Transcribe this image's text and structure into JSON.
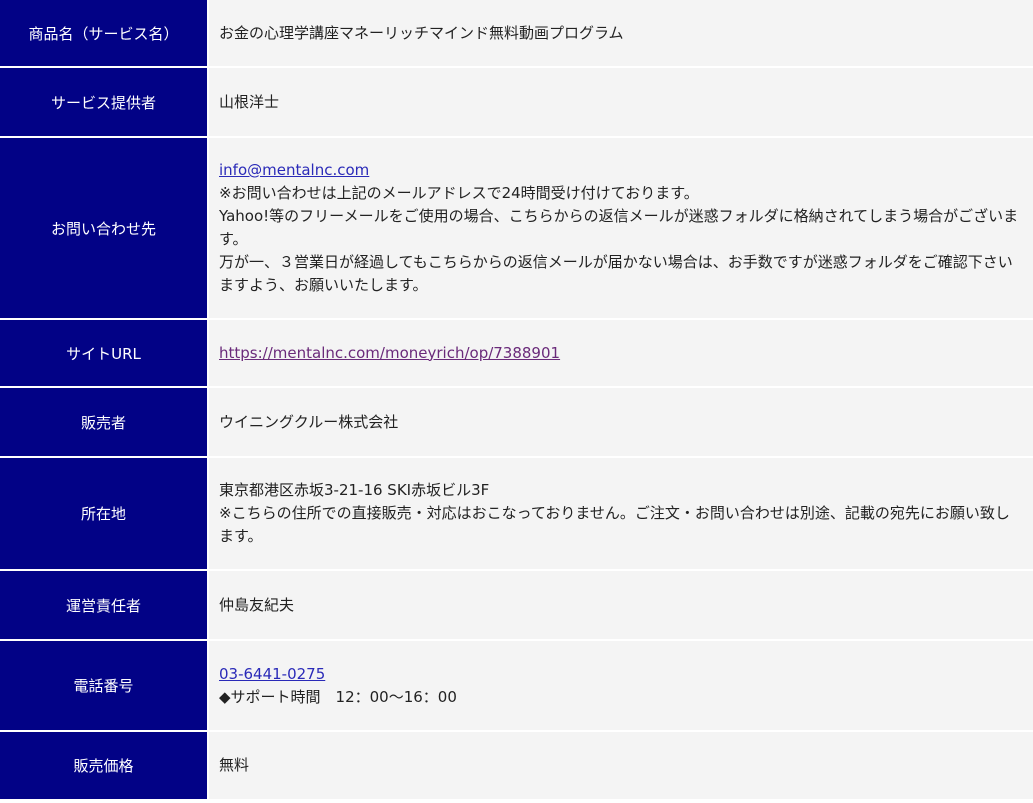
{
  "rows": {
    "product": {
      "label": "商品名（サービス名）",
      "value": "お金の心理学講座マネーリッチマインド無料動画プログラム"
    },
    "provider": {
      "label": "サービス提供者",
      "value": "山根洋士"
    },
    "contact": {
      "label": "お問い合わせ先",
      "email": "info@mentalnc.com",
      "note1": "※お問い合わせは上記のメールアドレスで24時間受け付けております。",
      "note2": "Yahoo!等のフリーメールをご使用の場合、こちらからの返信メールが迷惑フォルダに格納されてしまう場合がございます。",
      "note3": "万が一、３営業日が経過してもこちらからの返信メールが届かない場合は、お手数ですが迷惑フォルダをご確認下さいますよう、お願いいたします。"
    },
    "site": {
      "label": "サイトURL",
      "url": "https://mentalnc.com/moneyrich/op/7388901"
    },
    "seller": {
      "label": "販売者",
      "value": "ウイニングクルー株式会社"
    },
    "address": {
      "label": "所在地",
      "value": "東京都港区赤坂3-21-16 SKI赤坂ビル3F",
      "note": "※こちらの住所での直接販売・対応はおこなっておりません。ご注文・お問い合わせは別途、記載の宛先にお願い致します。"
    },
    "manager": {
      "label": "運営責任者",
      "value": "仲島友紀夫"
    },
    "phone": {
      "label": "電話番号",
      "number": "03-6441-0275",
      "hours": "◆サポート時間　12：00～16：00"
    },
    "price": {
      "label": "販売価格",
      "value": "無料"
    }
  },
  "colors": {
    "header_bg": "#020286",
    "cell_bg": "#f4f4f4",
    "link": "#2a2ab8",
    "visited_link": "#6a2a7a"
  }
}
